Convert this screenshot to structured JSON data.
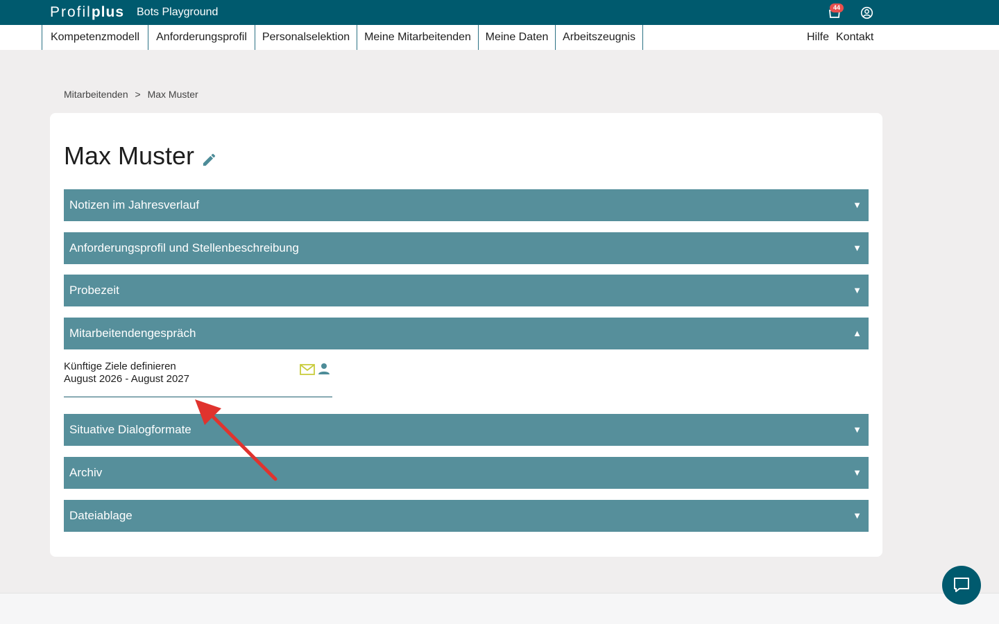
{
  "header": {
    "logo_light": "Profil",
    "logo_bold": "plus",
    "workspace": "Bots Playground",
    "cart_badge": "44",
    "icons": [
      "cart-icon",
      "account-icon"
    ]
  },
  "nav": {
    "items": [
      {
        "label": "Kompetenzmodell"
      },
      {
        "label": "Anforderungsprofil"
      },
      {
        "label": "Personalselektion"
      },
      {
        "label": "Meine Mitarbeitenden"
      },
      {
        "label": "Meine Daten"
      },
      {
        "label": "Arbeitszeugnis"
      }
    ],
    "help": "Hilfe",
    "contact": "Kontakt"
  },
  "breadcrumb": {
    "parent": "Mitarbeitenden",
    "separator": ">",
    "current": "Max Muster"
  },
  "page": {
    "title": "Max Muster"
  },
  "accordion": [
    {
      "label": "Notizen im Jahresverlauf",
      "chevron": "▼"
    },
    {
      "label": "Anforderungsprofil und Stellenbeschreibung",
      "chevron": "▼"
    },
    {
      "label": "Probezeit",
      "chevron": "▼"
    },
    {
      "label": "Mitarbeitendengespräch",
      "chevron": "▲"
    },
    {
      "label": "Situative Dialogformate",
      "chevron": "▼"
    },
    {
      "label": "Archiv",
      "chevron": "▼"
    },
    {
      "label": "Dateiablage",
      "chevron": "▼"
    }
  ],
  "entry": {
    "title": "Künftige Ziele definieren",
    "date_range": "August 2026 - August 2027"
  },
  "colors": {
    "topbar": "#005a6e",
    "accordion": "#568f9b",
    "mail_icon": "#c8cc3c",
    "annotation_arrow": "#e0332e"
  }
}
